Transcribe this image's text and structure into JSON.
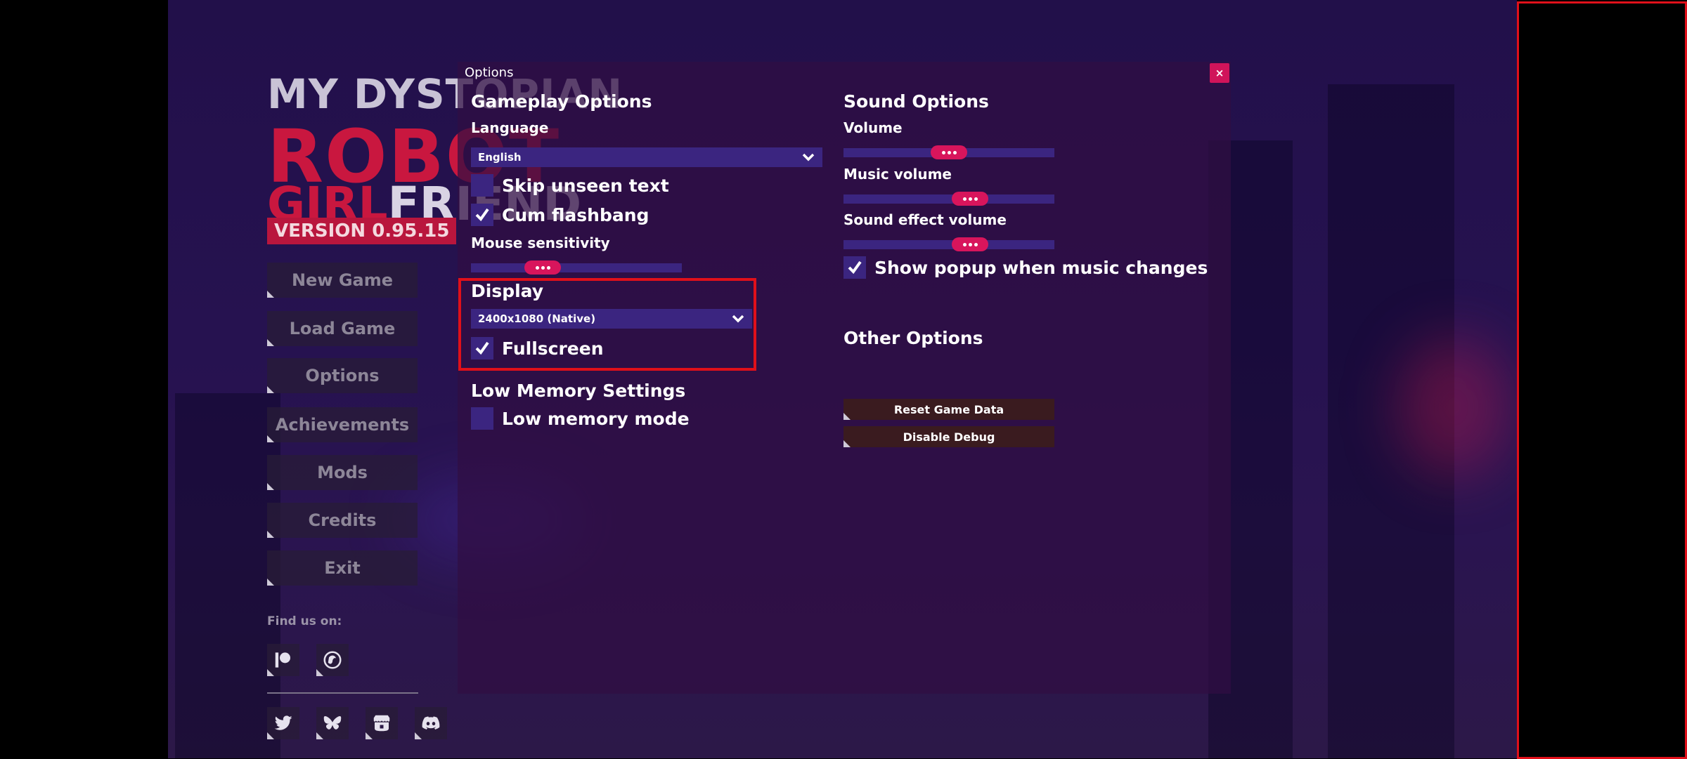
{
  "logo": {
    "line1": "MY DYSTOPIAN",
    "line2": "ROBOT",
    "line3a": "GIRL",
    "line3b": "FRIEND",
    "version": "VERSION 0.95.15"
  },
  "menu": [
    {
      "label": "New Game"
    },
    {
      "label": "Load Game"
    },
    {
      "label": "Options"
    },
    {
      "label": "Achievements"
    },
    {
      "label": "Mods"
    },
    {
      "label": "Credits"
    },
    {
      "label": "Exit"
    }
  ],
  "find_us": "Find us on:",
  "social_icons": [
    "patreon-icon",
    "website-icon",
    "twitter-icon",
    "bluesky-icon",
    "itchio-icon",
    "discord-icon"
  ],
  "options": {
    "title": "Options",
    "close_label": "×",
    "gameplay": {
      "heading": "Gameplay Options",
      "language_label": "Language",
      "language_value": "English",
      "skip_unseen_label": "Skip unseen text",
      "skip_unseen_checked": false,
      "cum_flashbang_label": "Cum flashbang",
      "cum_flashbang_checked": true,
      "mouse_sensitivity_label": "Mouse sensitivity",
      "mouse_sensitivity_level": 0.34
    },
    "display": {
      "heading": "Display",
      "resolution_value": "2400x1080 (Native)",
      "fullscreen_label": "Fullscreen",
      "fullscreen_checked": true
    },
    "low_memory": {
      "heading": "Low Memory Settings",
      "low_memory_label": "Low memory mode",
      "low_memory_checked": false
    },
    "sound": {
      "heading": "Sound Options",
      "volume_label": "Volume",
      "volume_level": 0.5,
      "music_volume_label": "Music volume",
      "music_volume_level": 0.6,
      "sfx_volume_label": "Sound effect volume",
      "sfx_volume_level": 0.6,
      "popup_label": "Show popup when music changes",
      "popup_checked": true
    },
    "other": {
      "heading": "Other Options",
      "reset_label": "Reset Game Data",
      "debug_label": "Disable Debug"
    }
  },
  "colors": {
    "accent": "#d8155c",
    "control": "#3b2580",
    "highlight": "#e0101a"
  }
}
